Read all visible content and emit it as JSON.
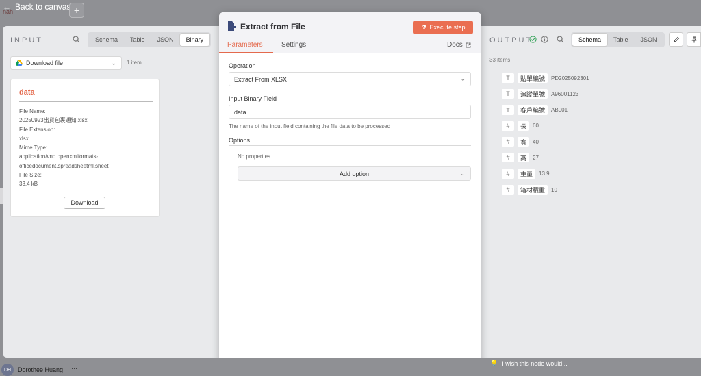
{
  "topbar": {
    "back_label": "Back to canvas",
    "workflow_name": "nah",
    "add_icon": "plus-icon"
  },
  "input": {
    "heading": "INPUT",
    "view_tabs": [
      "Schema",
      "Table",
      "JSON",
      "Binary"
    ],
    "active_view": "Binary",
    "source_select": "Download file",
    "item_count": "1 item",
    "card": {
      "title": "data",
      "file_name_label": "File Name:",
      "file_name": "20250923出貨包裹通知.xlsx",
      "ext_label": "File Extension:",
      "ext": "xlsx",
      "mime_label": "Mime Type:",
      "mime_1": "application/vnd.openxmlformats-",
      "mime_2": "officedocument.spreadsheetml.sheet",
      "size_label": "File Size:",
      "size": "33.4 kB",
      "download_label": "Download"
    }
  },
  "node": {
    "title": "Extract from File",
    "execute_label": "Execute step",
    "tabs": [
      "Parameters",
      "Settings"
    ],
    "active_tab": "Parameters",
    "docs_label": "Docs",
    "operation_label": "Operation",
    "operation_value": "Extract From XLSX",
    "binary_field_label": "Input Binary Field",
    "binary_field_value": "data",
    "binary_field_hint": "The name of the input field containing the file data to be processed",
    "options_label": "Options",
    "no_properties": "No properties",
    "add_option_label": "Add option"
  },
  "output": {
    "heading": "OUTPUT",
    "item_count": "33 items",
    "view_tabs": [
      "Schema",
      "Table",
      "JSON"
    ],
    "active_view": "Schema",
    "fields": [
      {
        "type": "T",
        "key": "貼單編號",
        "value": "PD2025092301"
      },
      {
        "type": "T",
        "key": "追蹤單號",
        "value": "A96001123"
      },
      {
        "type": "T",
        "key": "客戶編號",
        "value": "AB001"
      },
      {
        "type": "#",
        "key": "長",
        "value": "60"
      },
      {
        "type": "#",
        "key": "寬",
        "value": "40"
      },
      {
        "type": "#",
        "key": "高",
        "value": "27"
      },
      {
        "type": "#",
        "key": "重量",
        "value": "13.9"
      },
      {
        "type": "#",
        "key": "箱材積重",
        "value": "10"
      }
    ]
  },
  "footer": {
    "avatar_initials": "DH",
    "user_name": "Dorothee Huang",
    "more": "···",
    "wish_text": "I wish this node would..."
  },
  "colors": {
    "accent": "#e46a4d",
    "execute_bg": "#ea6e51",
    "success": "#3aa55d"
  }
}
